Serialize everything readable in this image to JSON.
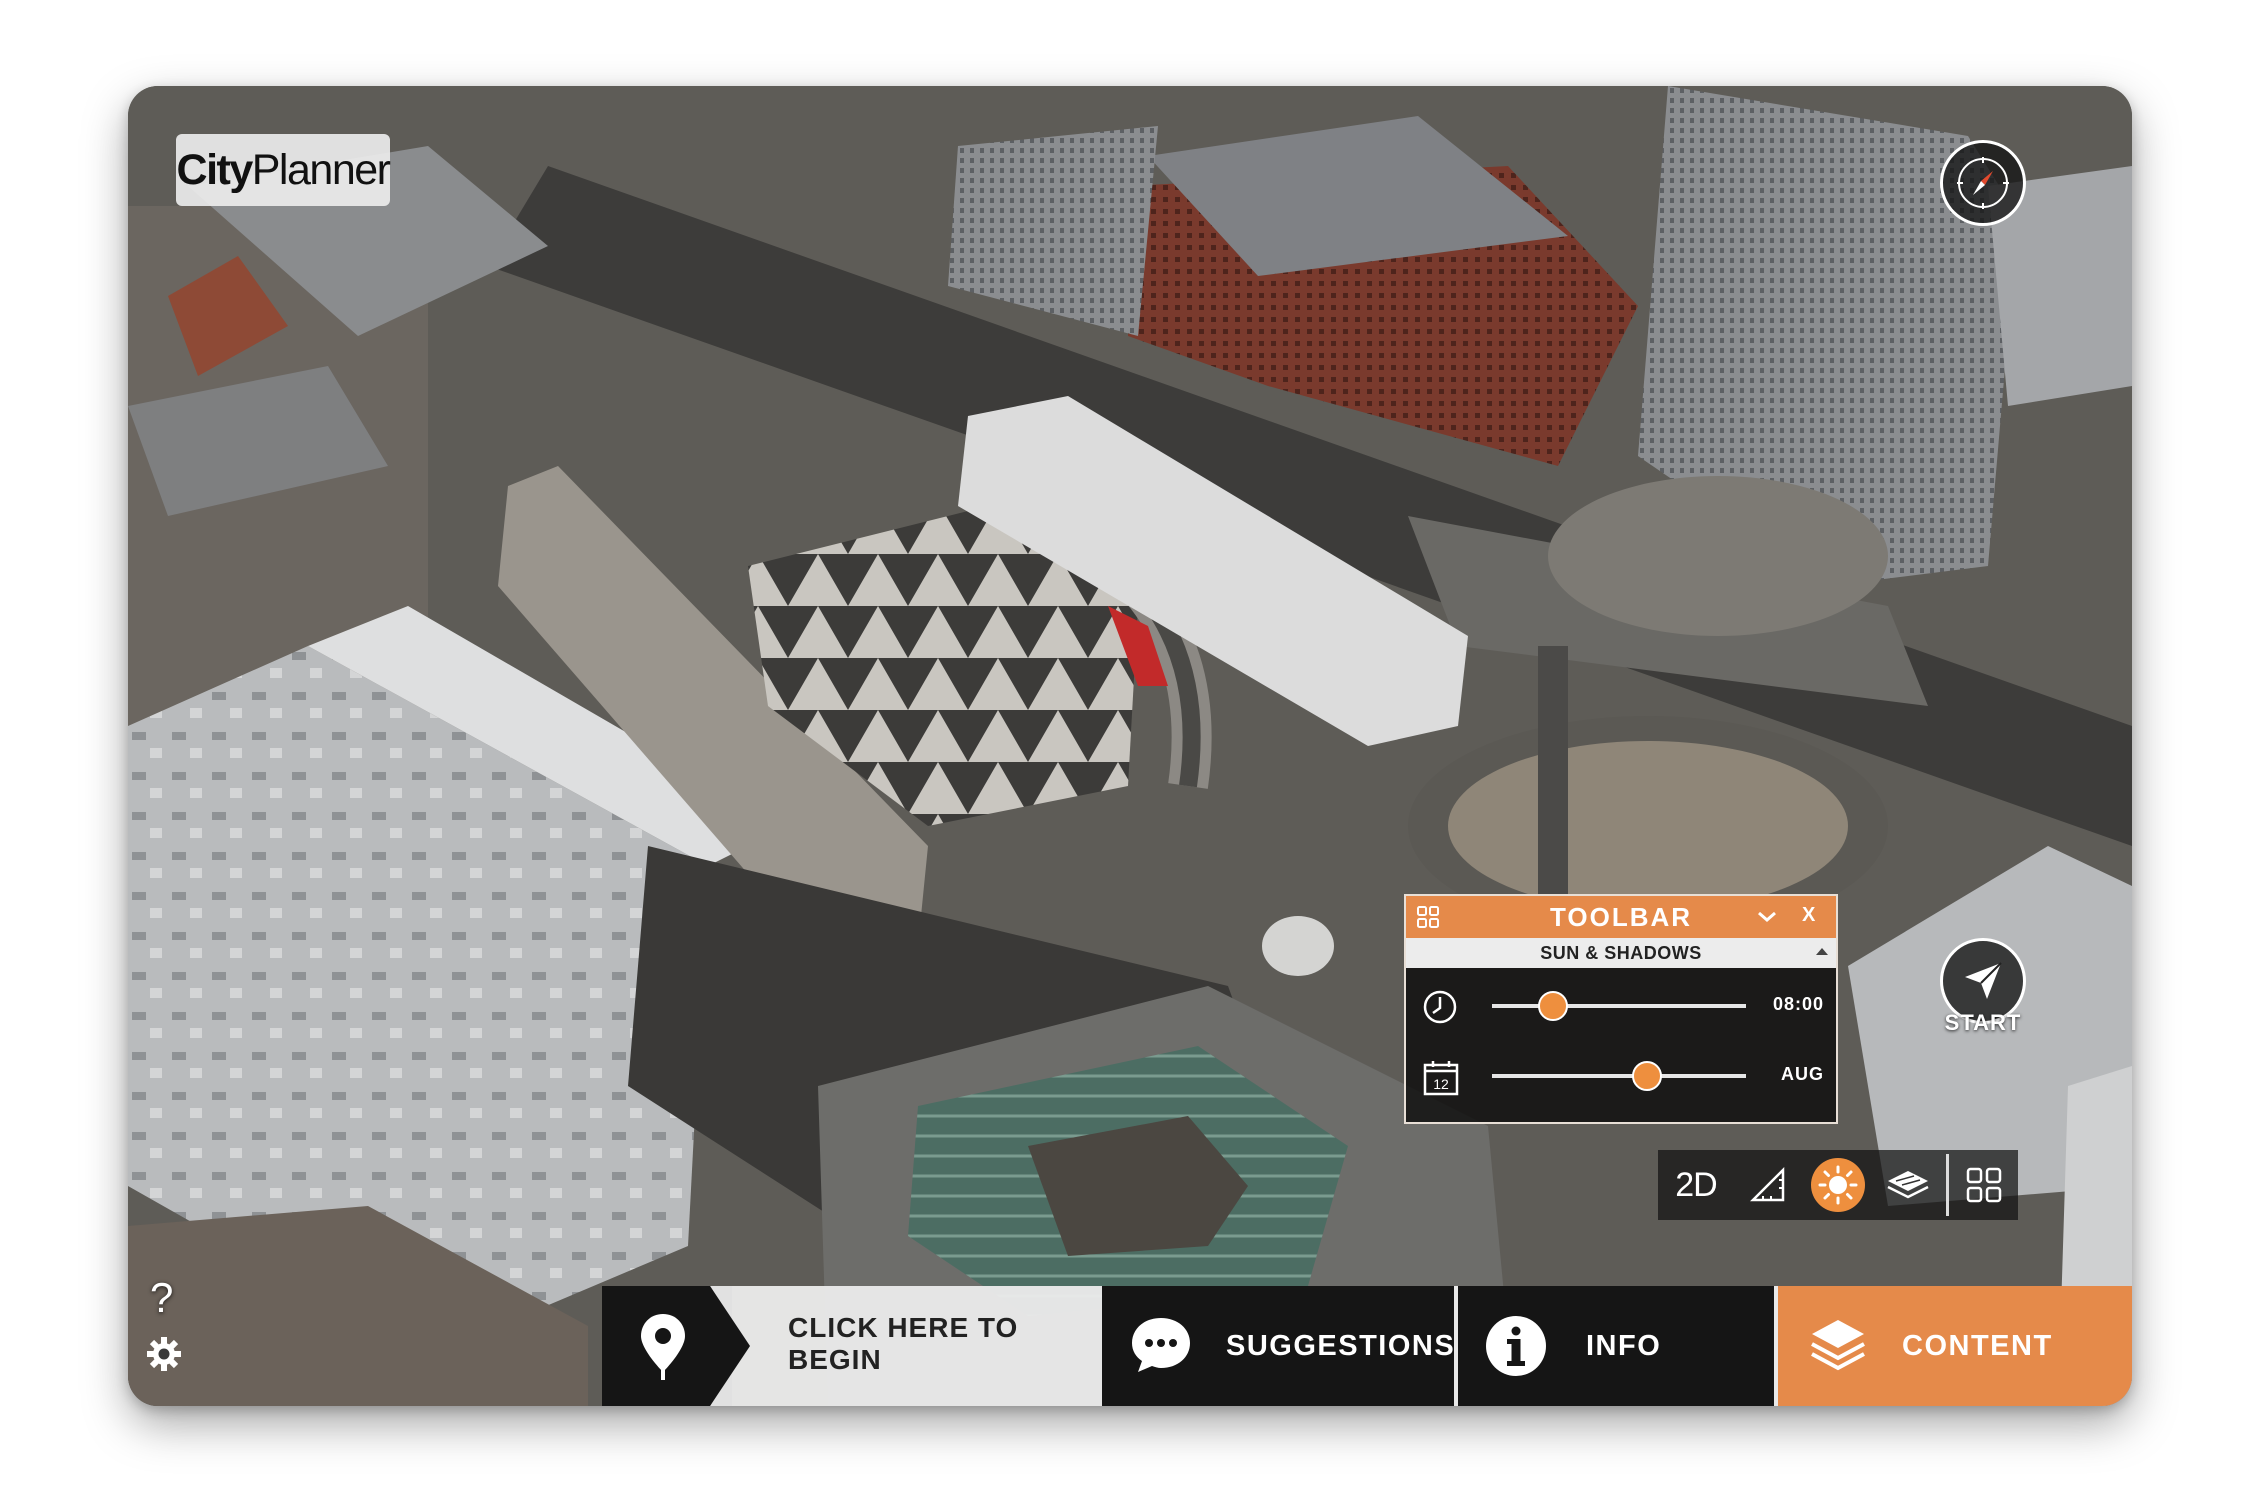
{
  "app": {
    "logo_bold": "City",
    "logo_regular": "Planner"
  },
  "map": {
    "start_label": "START"
  },
  "toolbar": {
    "title": "TOOLBAR",
    "close_label": "X",
    "section": "SUN & SHADOWS",
    "time_value": "08:00",
    "time_fraction": 0.24,
    "calendar_day": "12",
    "month_value": "AUG",
    "month_fraction": 0.61
  },
  "tools": {
    "view_mode_label": "2D"
  },
  "side": {
    "help_label": "?"
  },
  "bottom_bar": {
    "begin_label": "CLICK HERE TO BEGIN",
    "suggestions_label": "SUGGESTIONS",
    "info_label": "INFO",
    "content_label": "CONTENT"
  },
  "colors": {
    "accent": "#e58a4a",
    "bar": "#151515",
    "slider_knob": "#ee8f3e"
  },
  "icons": [
    "compass-icon",
    "start-navigation-icon",
    "grid-icon",
    "chevron-down-icon",
    "clock-icon",
    "calendar-icon",
    "ruler-icon",
    "sun-icon",
    "3d-layers-icon",
    "help-icon",
    "gear-icon",
    "map-pin-icon",
    "chat-bubble-icon",
    "info-icon",
    "layers-icon"
  ]
}
